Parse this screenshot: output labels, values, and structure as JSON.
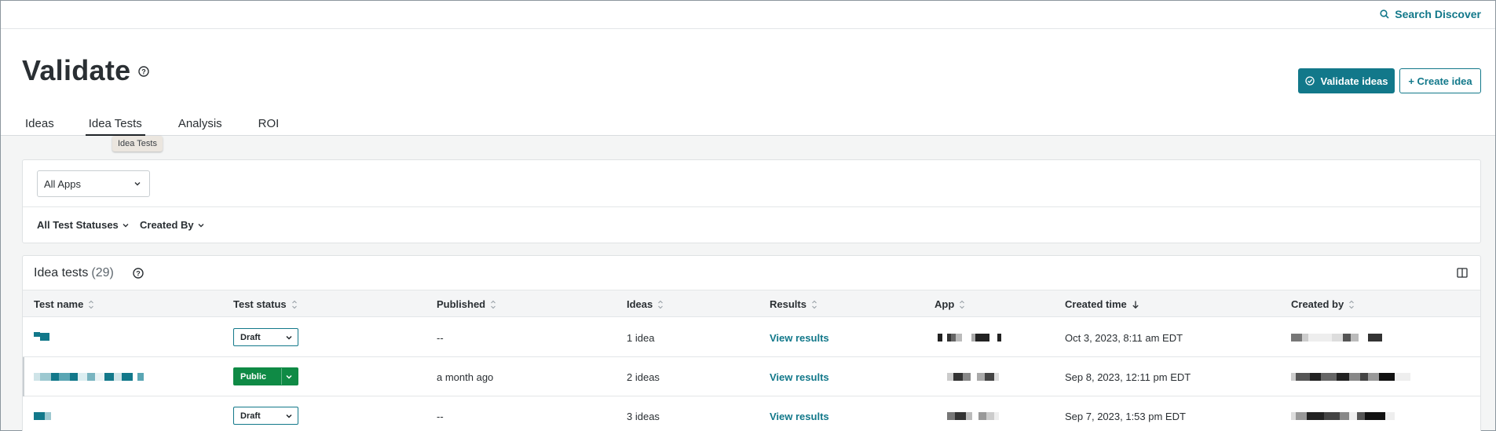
{
  "topbar": {
    "search_label": "Search Discover"
  },
  "header": {
    "title": "Validate",
    "validate_button": "Validate ideas",
    "create_button": "+ Create idea",
    "tabs": [
      {
        "label": "Ideas",
        "active": false
      },
      {
        "label": "Idea Tests",
        "active": true
      },
      {
        "label": "Analysis",
        "active": false
      },
      {
        "label": "ROI",
        "active": false
      }
    ],
    "tooltip": "Idea Tests"
  },
  "filters": {
    "apps_select": "All Apps",
    "status_filter": "All Test Statuses",
    "created_by_filter": "Created By"
  },
  "table": {
    "title": "Idea tests",
    "count": "(29)",
    "columns": [
      "Test name",
      "Test status",
      "Published",
      "Ideas",
      "Results",
      "App",
      "Created time",
      "Created by"
    ],
    "rows": [
      {
        "status": "Draft",
        "published": "--",
        "ideas": "1 idea",
        "results": "View results",
        "created_time": "Oct 3, 2023, 8:11 am EDT"
      },
      {
        "status": "Public",
        "published": "a month ago",
        "ideas": "2 ideas",
        "results": "View results",
        "created_time": "Sep 8, 2023, 12:11 pm EDT"
      },
      {
        "status": "Draft",
        "published": "--",
        "ideas": "3 ideas",
        "results": "View results",
        "created_time": "Sep 7, 2023, 1:53 pm EDT"
      }
    ]
  },
  "colors": {
    "accent": "#12788a",
    "public_status": "#0f8a45"
  },
  "icons": [
    "search-icon",
    "help-icon",
    "check-circle-icon",
    "chevron-down-icon",
    "sort-icon",
    "sort-desc-icon",
    "columns-icon"
  ]
}
